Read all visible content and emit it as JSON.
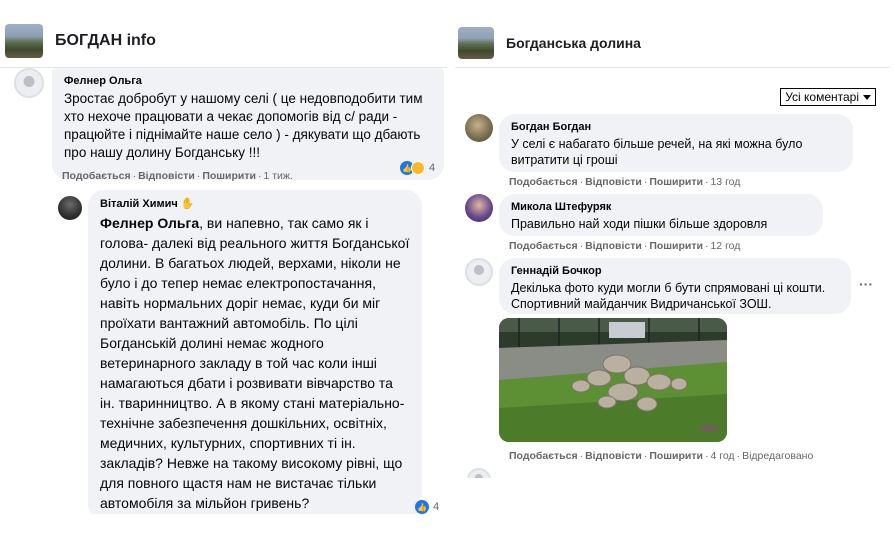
{
  "left": {
    "page_title": "БОГДАН info",
    "comment1": {
      "author": "Фелнер Ольга",
      "text": "Зростає добробут у нашому селі ( це недовподобити тим хто нехоче працювати а чекає допомогів від с/ ради - працюйте і піднімайте наше село ) - дякувати що дбають про нашу долину Богданську !!!",
      "actions": {
        "like": "Подобається",
        "reply": "Відповісти",
        "share": "Поширити",
        "time": "1 тиж."
      },
      "reaction_count": "4"
    },
    "comment2": {
      "author": "Віталій Химич",
      "mention": "Фелнер Ольга",
      "text": ", ви напевно, так само як і голова- далекі від реального життя Богданської долини. В багатьох людей, верхами, ніколи не було і до тепер немає електропостачання, навіть нормальних доріг немає, куди би міг проїхати вантажний автомобіль. По цілі Богданській долині немає жодного ветеринарного закладу в той час коли інші намагаються дбати і розвивати вівчарство та ін. тваринництво. А в якому стані матеріально-технічне забезпечення дошкільних, освітніх, медичних, культурних, спортивних ті ін. закладів? Невже на такому високому рівні, що для повного щастя нам не вистачає тільки автомобіля за мільйон гривень?",
      "reaction_count": "4"
    }
  },
  "right": {
    "page_title": "Богданська долина",
    "sort_label": "Усі коментарі",
    "comments": [
      {
        "author": "Богдан Богдан",
        "text": "У селі є набагато більше речей, на які можна було витратити ці гроші",
        "actions": {
          "like": "Подобається",
          "reply": "Відповісти",
          "share": "Поширити",
          "time": "13 год"
        }
      },
      {
        "author": "Микола Штефуряк",
        "text": "Правильно най ходи пішки більше здоровля",
        "actions": {
          "like": "Подобається",
          "reply": "Відповісти",
          "share": "Поширити",
          "time": "12 год"
        }
      },
      {
        "author": "Геннадій Бочкор",
        "text": "Декілька фото куди могли б бути спрямовані ці кошти. Спортивний майданчик Видричанської ЗОШ.",
        "more": "···",
        "actions": {
          "like": "Подобається",
          "reply": "Відповісти",
          "share": "Поширити",
          "time": "4 год",
          "edited": "Відредаговано"
        }
      }
    ]
  },
  "colors": {
    "bubble": "#f0f2f5",
    "meta": "#65676b",
    "like_blue": "#1877f2"
  }
}
